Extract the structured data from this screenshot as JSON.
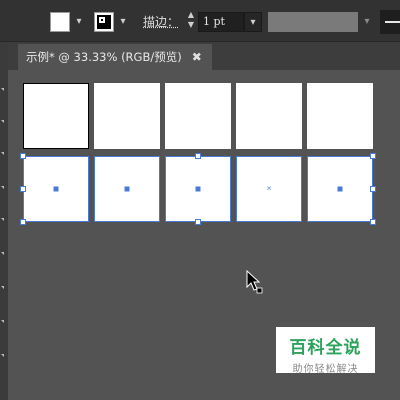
{
  "control_bar": {
    "fill_color": "#ffffff",
    "stroke_label": "描边：",
    "stroke_weight": "1 pt",
    "chevron": "▾",
    "stepper_up": "▲",
    "stepper_down": "▼"
  },
  "tab": {
    "title": "示例* @ 33.33% (RGB/预览)",
    "close": "✖"
  },
  "artboards": {
    "rows": 2,
    "columns": 5,
    "selected_row": 2,
    "selection_color": "#4a7bd4"
  },
  "watermark": {
    "title": "百科全说",
    "subtitle": "助你轻松解决",
    "color": "#2da25a"
  }
}
